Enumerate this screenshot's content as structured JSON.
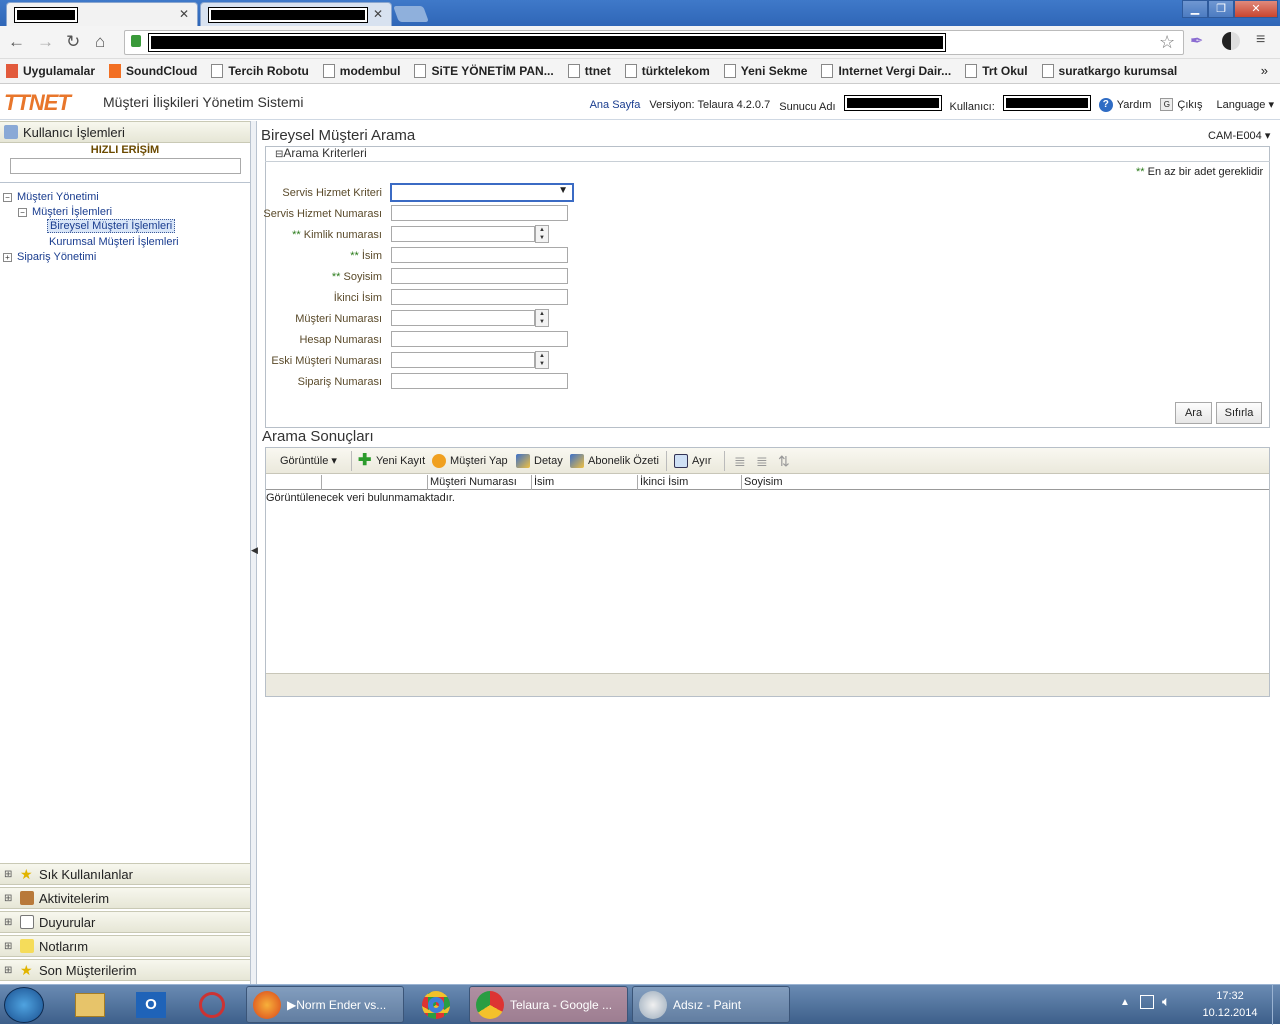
{
  "browser": {
    "menu_icon": "hamburger-icon",
    "bookmarks": [
      {
        "label": "Uygulamalar",
        "icon": "apps-grid-icon"
      },
      {
        "label": "SoundCloud",
        "icon": "soundcloud-icon"
      },
      {
        "label": "Tercih Robotu",
        "icon": "page-icon"
      },
      {
        "label": "modembul",
        "icon": "page-icon"
      },
      {
        "label": "SiTE YÖNETİM PAN...",
        "icon": "page-icon"
      },
      {
        "label": "ttnet",
        "icon": "page-icon"
      },
      {
        "label": "türktelekom",
        "icon": "page-icon"
      },
      {
        "label": "Yeni Sekme",
        "icon": "page-icon"
      },
      {
        "label": "Internet Vergi Dair...",
        "icon": "page-icon"
      },
      {
        "label": "Trt Okul",
        "icon": "page-icon"
      },
      {
        "label": "suratkargo kurumsal",
        "icon": "page-icon"
      }
    ],
    "overflow": "»"
  },
  "header": {
    "logo": "TTNET",
    "title": "Müşteri İlişkileri Yönetim Sistemi",
    "home": "Ana Sayfa",
    "version": "Versiyon: Telaura 4.2.0.7",
    "server_label": "Sunucu Adı",
    "user_label": "Kullanıcı:",
    "help": "Yardım",
    "logout": "Çıkış",
    "language": "Language"
  },
  "left": {
    "user_ops": "Kullanıcı İşlemleri",
    "quick_access": "HIZLI ERİŞİM",
    "tree": {
      "customer_mgmt": "Müşteri Yönetimi",
      "customer_ops": "Müşteri İşlemleri",
      "individual": "Bireysel Müşteri İşlemleri",
      "corporate": "Kurumsal Müşteri İşlemleri",
      "order_mgmt": "Sipariş Yönetimi"
    },
    "panels": [
      "Sık Kullanılanlar",
      "Aktivitelerim",
      "Duyurular",
      "Notlarım",
      "Son Müşterilerim"
    ]
  },
  "search": {
    "title": "Bireysel Müşteri Arama",
    "screen_code": "CAM-E004",
    "criteria_title": "Arama Kriterleri",
    "required_note_mark": "**",
    "required_note": "En az bir adet gereklidir",
    "fields": {
      "service_criteria": "Servis Hizmet Kriteri",
      "service_number": "Servis Hizmet Numarası",
      "id_number": "Kimlik numarası",
      "first_name": "İsim",
      "last_name": "Soyisim",
      "middle_name": "İkinci İsim",
      "customer_number": "Müşteri Numarası",
      "account_number": "Hesap Numarası",
      "old_customer_number": "Eski Müşteri Numarası",
      "order_number": "Sipariş Numarası"
    },
    "search_btn": "Ara",
    "reset_btn": "Sıfırla"
  },
  "results": {
    "title": "Arama Sonuçları",
    "toolbar": {
      "view": "Görüntüle",
      "new_record": "Yeni Kayıt",
      "make_customer": "Müşteri Yap",
      "detail": "Detay",
      "subscription_summary": "Abonelik Özeti",
      "detach": "Ayır"
    },
    "columns": [
      "Müşteri Numarası",
      "İsim",
      "İkinci İsim",
      "Soyisim"
    ],
    "empty": "Görüntülenecek veri bulunmamaktadır."
  },
  "taskbar": {
    "tasks": [
      "Norm Ender vs...",
      "Telaura - Google ...",
      "Adsız - Paint"
    ],
    "time": "17:32",
    "date": "10.12.2014"
  },
  "colors": {
    "accent": "#e8762b",
    "link": "#1a3d8f",
    "taskbar": "#3d5f8a"
  }
}
